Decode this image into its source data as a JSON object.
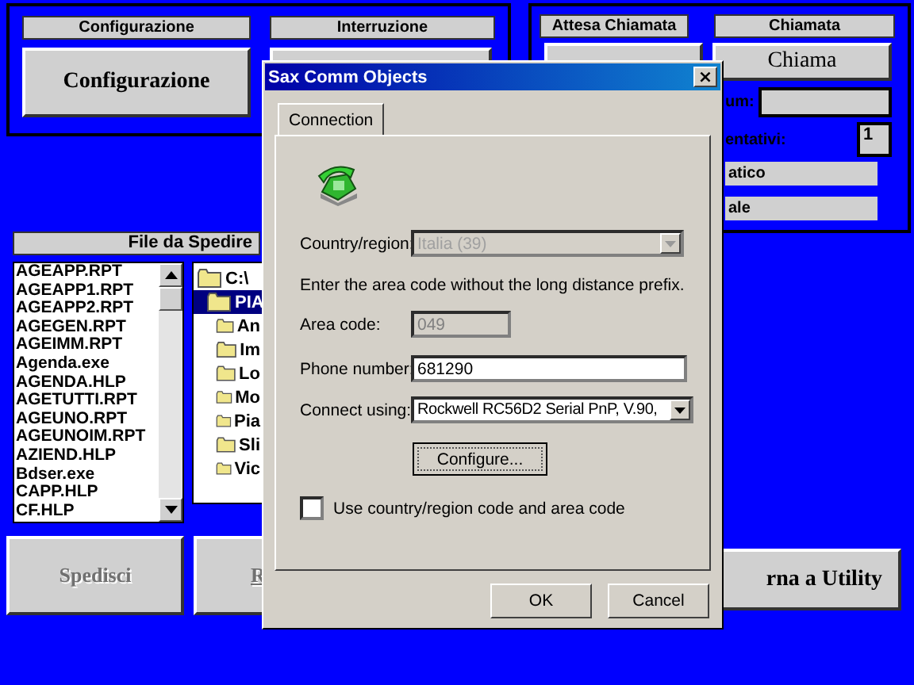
{
  "top_left_panel": {
    "labels": [
      "Configurazione",
      "Interruzione"
    ],
    "configure_button": {
      "label": "Configurazione",
      "disabled": false
    }
  },
  "top_right_panel": {
    "labels": [
      "Attesa Chiamata",
      "Chiamata"
    ],
    "call_button": {
      "label": "Chiama"
    },
    "num_label": "um:",
    "attempts_label": "entativi:",
    "attempts_value": "1",
    "mode_bars": [
      "atico",
      "ale"
    ]
  },
  "file_section": {
    "title": "File da Spedire",
    "files": [
      {
        "name": "AGEAPP.RPT"
      },
      {
        "name": "AGEAPP1.RPT"
      },
      {
        "name": "AGEAPP2.RPT"
      },
      {
        "name": "AGEGEN.RPT"
      },
      {
        "name": "AGEIMM.RPT"
      },
      {
        "name": "Agenda.exe"
      },
      {
        "name": "AGENDA.HLP"
      },
      {
        "name": "AGETUTTI.RPT"
      },
      {
        "name": "AGEUNO.RPT"
      },
      {
        "name": "AGEUNOIM.RPT"
      },
      {
        "name": "AZIEND.HLP"
      },
      {
        "name": "Bdser.exe"
      },
      {
        "name": "CAPP.HLP"
      },
      {
        "name": "CF.HLP"
      }
    ],
    "folders": [
      {
        "name": "C:\\",
        "selected": false,
        "children": [
          {
            "name": "PIA",
            "selected": true,
            "children": [
              {
                "name": "An",
                "selected": false
              },
              {
                "name": "Im",
                "selected": false
              },
              {
                "name": "Lo",
                "selected": false
              },
              {
                "name": "Mo",
                "selected": false
              },
              {
                "name": "Pia",
                "selected": false
              },
              {
                "name": "Sli",
                "selected": false
              },
              {
                "name": "Vic",
                "selected": false
              }
            ]
          }
        ]
      }
    ]
  },
  "bottom_buttons": [
    {
      "label": "Spedisci",
      "disabled": true
    },
    {
      "label": "R",
      "disabled": true
    },
    {
      "label": "rna a Utility",
      "disabled": false
    }
  ],
  "dialog": {
    "title": "Sax Comm Objects",
    "close": "×",
    "tabs": [
      {
        "label": "Connection",
        "selected": true
      }
    ],
    "country": {
      "label": "Country/region:",
      "value": "Italia (39)",
      "disabled": true
    },
    "hint": "Enter the area code without the long distance prefix.",
    "area_code": {
      "label": "Area code:",
      "value": "049",
      "disabled": true
    },
    "phone": {
      "label": "Phone number:",
      "value": "681290",
      "disabled": false
    },
    "connect": {
      "label": "Connect using:",
      "value": "Rockwell RC56D2 Serial PnP, V.90,",
      "disabled": false
    },
    "configure_button": "Configure...",
    "use_country": {
      "label": "Use country/region code and area code",
      "checked": false
    },
    "buttons": [
      "OK",
      "Cancel"
    ]
  }
}
